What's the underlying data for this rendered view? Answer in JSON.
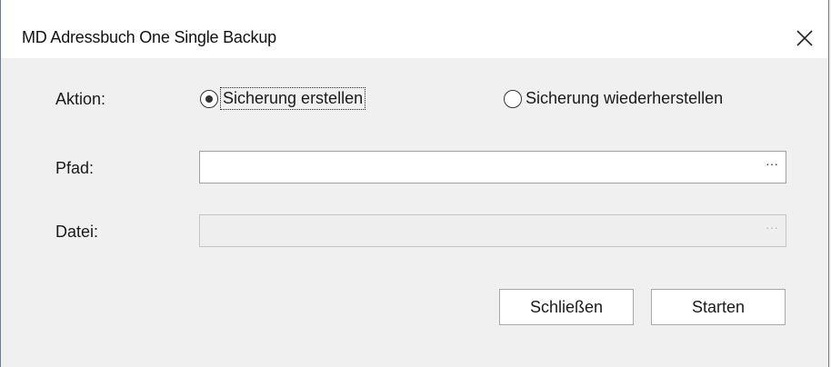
{
  "window": {
    "title": "MD Adressbuch One Single Backup",
    "close_icon": "close-icon"
  },
  "form": {
    "aktion_label": "Aktion:",
    "radio_create_label": "Sicherung erstellen",
    "radio_create_selected": true,
    "radio_restore_label": "Sicherung wiederherstellen",
    "radio_restore_selected": false,
    "pfad_label": "Pfad:",
    "pfad_value": "",
    "pfad_browse": "···",
    "datei_label": "Datei:",
    "datei_value": "",
    "datei_browse": "···",
    "datei_disabled": true
  },
  "buttons": {
    "close_label": "Schließen",
    "start_label": "Starten"
  }
}
